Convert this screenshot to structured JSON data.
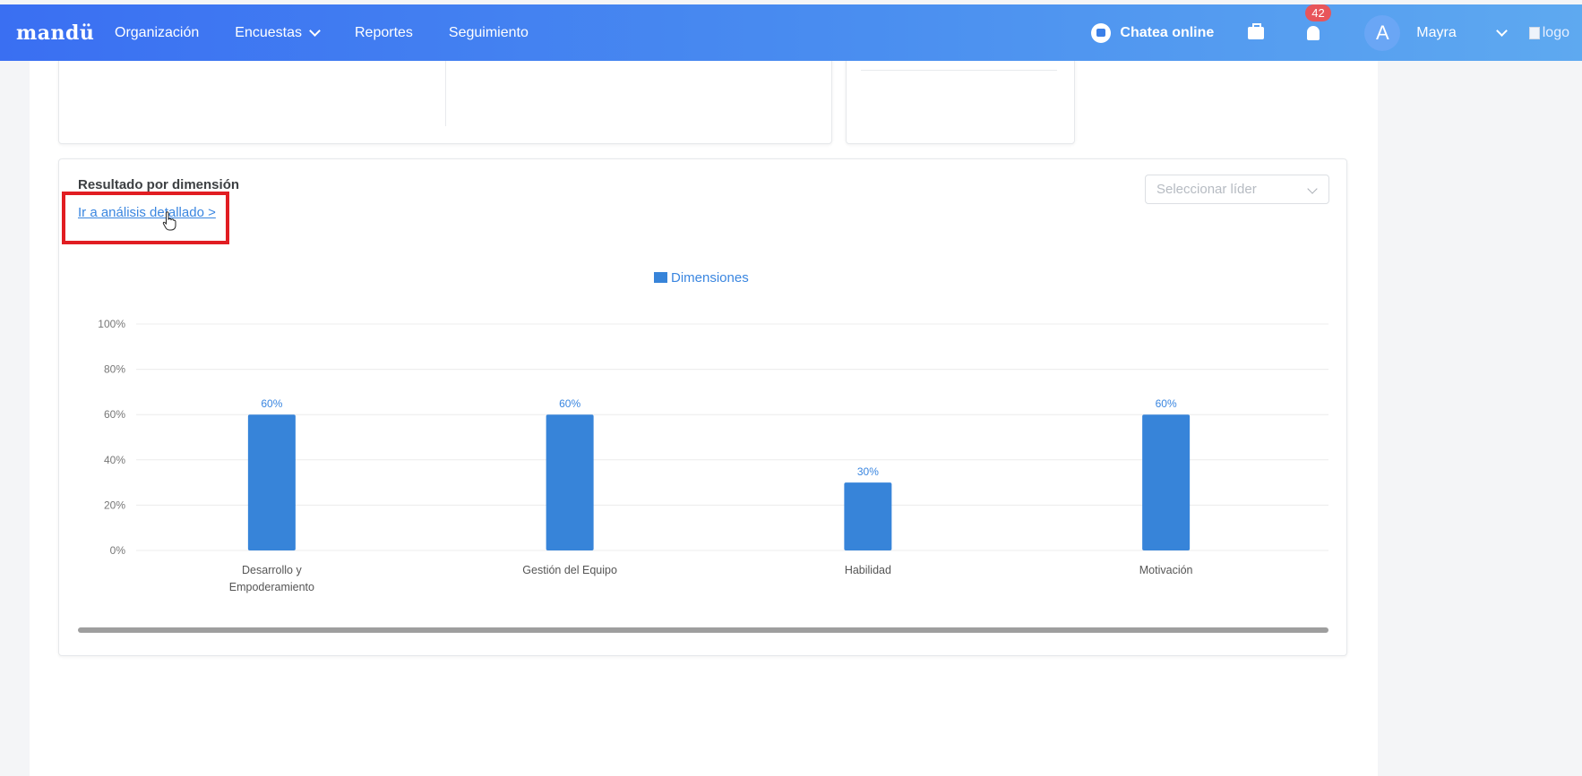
{
  "nav": {
    "logo": "mandü",
    "items": [
      "Organización",
      "Encuestas",
      "Reportes",
      "Seguimiento"
    ],
    "chat_label": "Chatea online",
    "notification_count": "42",
    "avatar_initial": "A",
    "user_name": "Mayra",
    "logo_alt": "logo"
  },
  "panel": {
    "title": "Resultado por dimensión",
    "link": "Ir a análisis detallado >",
    "leader_placeholder": "Seleccionar líder"
  },
  "colors": {
    "bar": "#3784d9",
    "accent": "#3a6ff2",
    "highlight": "#e11d22"
  },
  "chart_data": {
    "type": "bar",
    "legend": "Dimensiones",
    "categories": [
      [
        "Desarrollo y",
        "Empoderamiento"
      ],
      [
        "Gestión del Equipo"
      ],
      [
        "Habilidad"
      ],
      [
        "Motivación"
      ]
    ],
    "values": [
      60,
      60,
      30,
      60
    ],
    "value_labels": [
      "60%",
      "60%",
      "30%",
      "60%"
    ],
    "y_ticks": [
      "100%",
      "80%",
      "60%",
      "40%",
      "20%",
      "0%"
    ],
    "ylim": [
      0,
      100
    ],
    "grid": true
  }
}
